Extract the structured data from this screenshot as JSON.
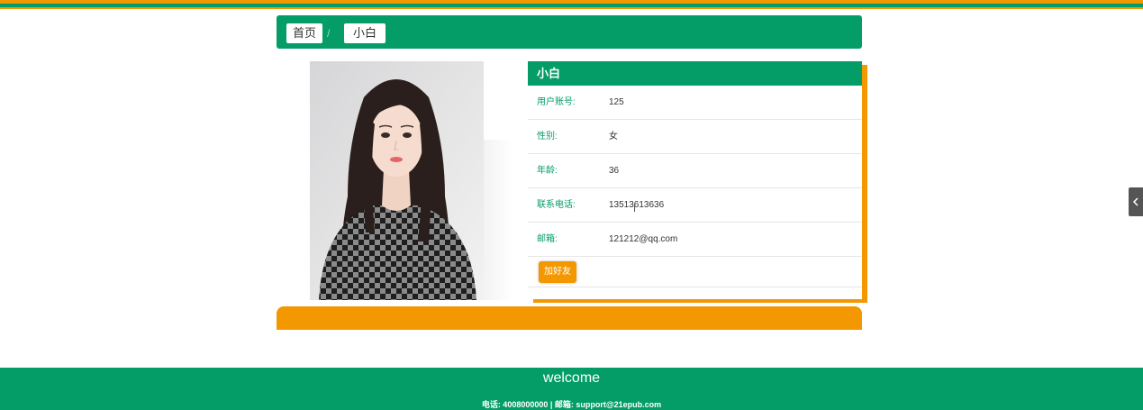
{
  "breadcrumb": {
    "home": "首页",
    "separator": "/",
    "current": "小白"
  },
  "profile": {
    "name": "小白",
    "photo_alt": "小白",
    "fields": [
      {
        "label": "用户账号:",
        "value": "125"
      },
      {
        "label": "性别:",
        "value": "女"
      },
      {
        "label": "年龄:",
        "value": "36"
      },
      {
        "label": "联系电话:",
        "value": "13513613636"
      },
      {
        "label": "邮箱:",
        "value": "121212@qq.com"
      }
    ],
    "add_friend_label": "加好友"
  },
  "footer": {
    "title": "welcome",
    "contact": "电话: 4008000000 | 邮箱: support@21epub.com"
  },
  "side_toggle": {
    "icon": "chevron-left-icon"
  },
  "colors": {
    "primary_green": "#059d67",
    "accent_orange": "#f39800"
  }
}
